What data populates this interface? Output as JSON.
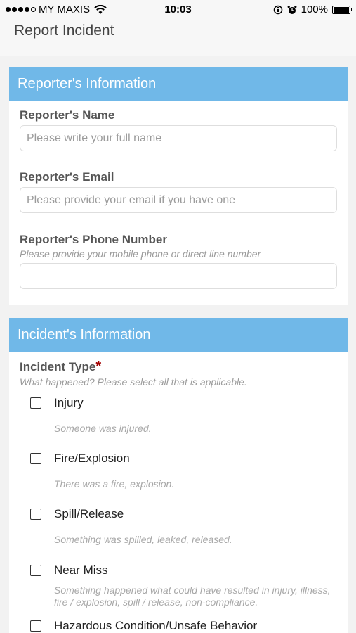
{
  "status_bar": {
    "carrier": "MY MAXIS",
    "time": "10:03",
    "battery": "100%"
  },
  "header": {
    "title": "Report Incident"
  },
  "reporter": {
    "section_title": "Reporter's Information",
    "name": {
      "label": "Reporter's Name",
      "placeholder": "Please write your full name",
      "value": ""
    },
    "email": {
      "label": "Reporter's Email",
      "placeholder": "Please provide your email if you have one",
      "value": ""
    },
    "phone": {
      "label": "Reporter's Phone Number",
      "help": "Please provide your mobile phone or direct line number",
      "value": ""
    }
  },
  "incident": {
    "section_title": "Incident's Information",
    "type_label": "Incident Type",
    "required_mark": "*",
    "type_help": "What happened? Please select all that is applicable.",
    "options": [
      {
        "label": "Injury",
        "description": "Someone was injured.",
        "checked": false
      },
      {
        "label": "Fire/Explosion",
        "description": "There was a fire, explosion.",
        "checked": false
      },
      {
        "label": "Spill/Release",
        "description": "Something was spilled, leaked, released.",
        "checked": false
      },
      {
        "label": "Near Miss",
        "description": "Something happened what could have resulted in injury, illness, fire / explosion, spill / release, non-compliance.",
        "checked": false
      },
      {
        "label": "Hazardous Condition/Unsafe Behavior",
        "description": "",
        "checked": false
      }
    ]
  }
}
